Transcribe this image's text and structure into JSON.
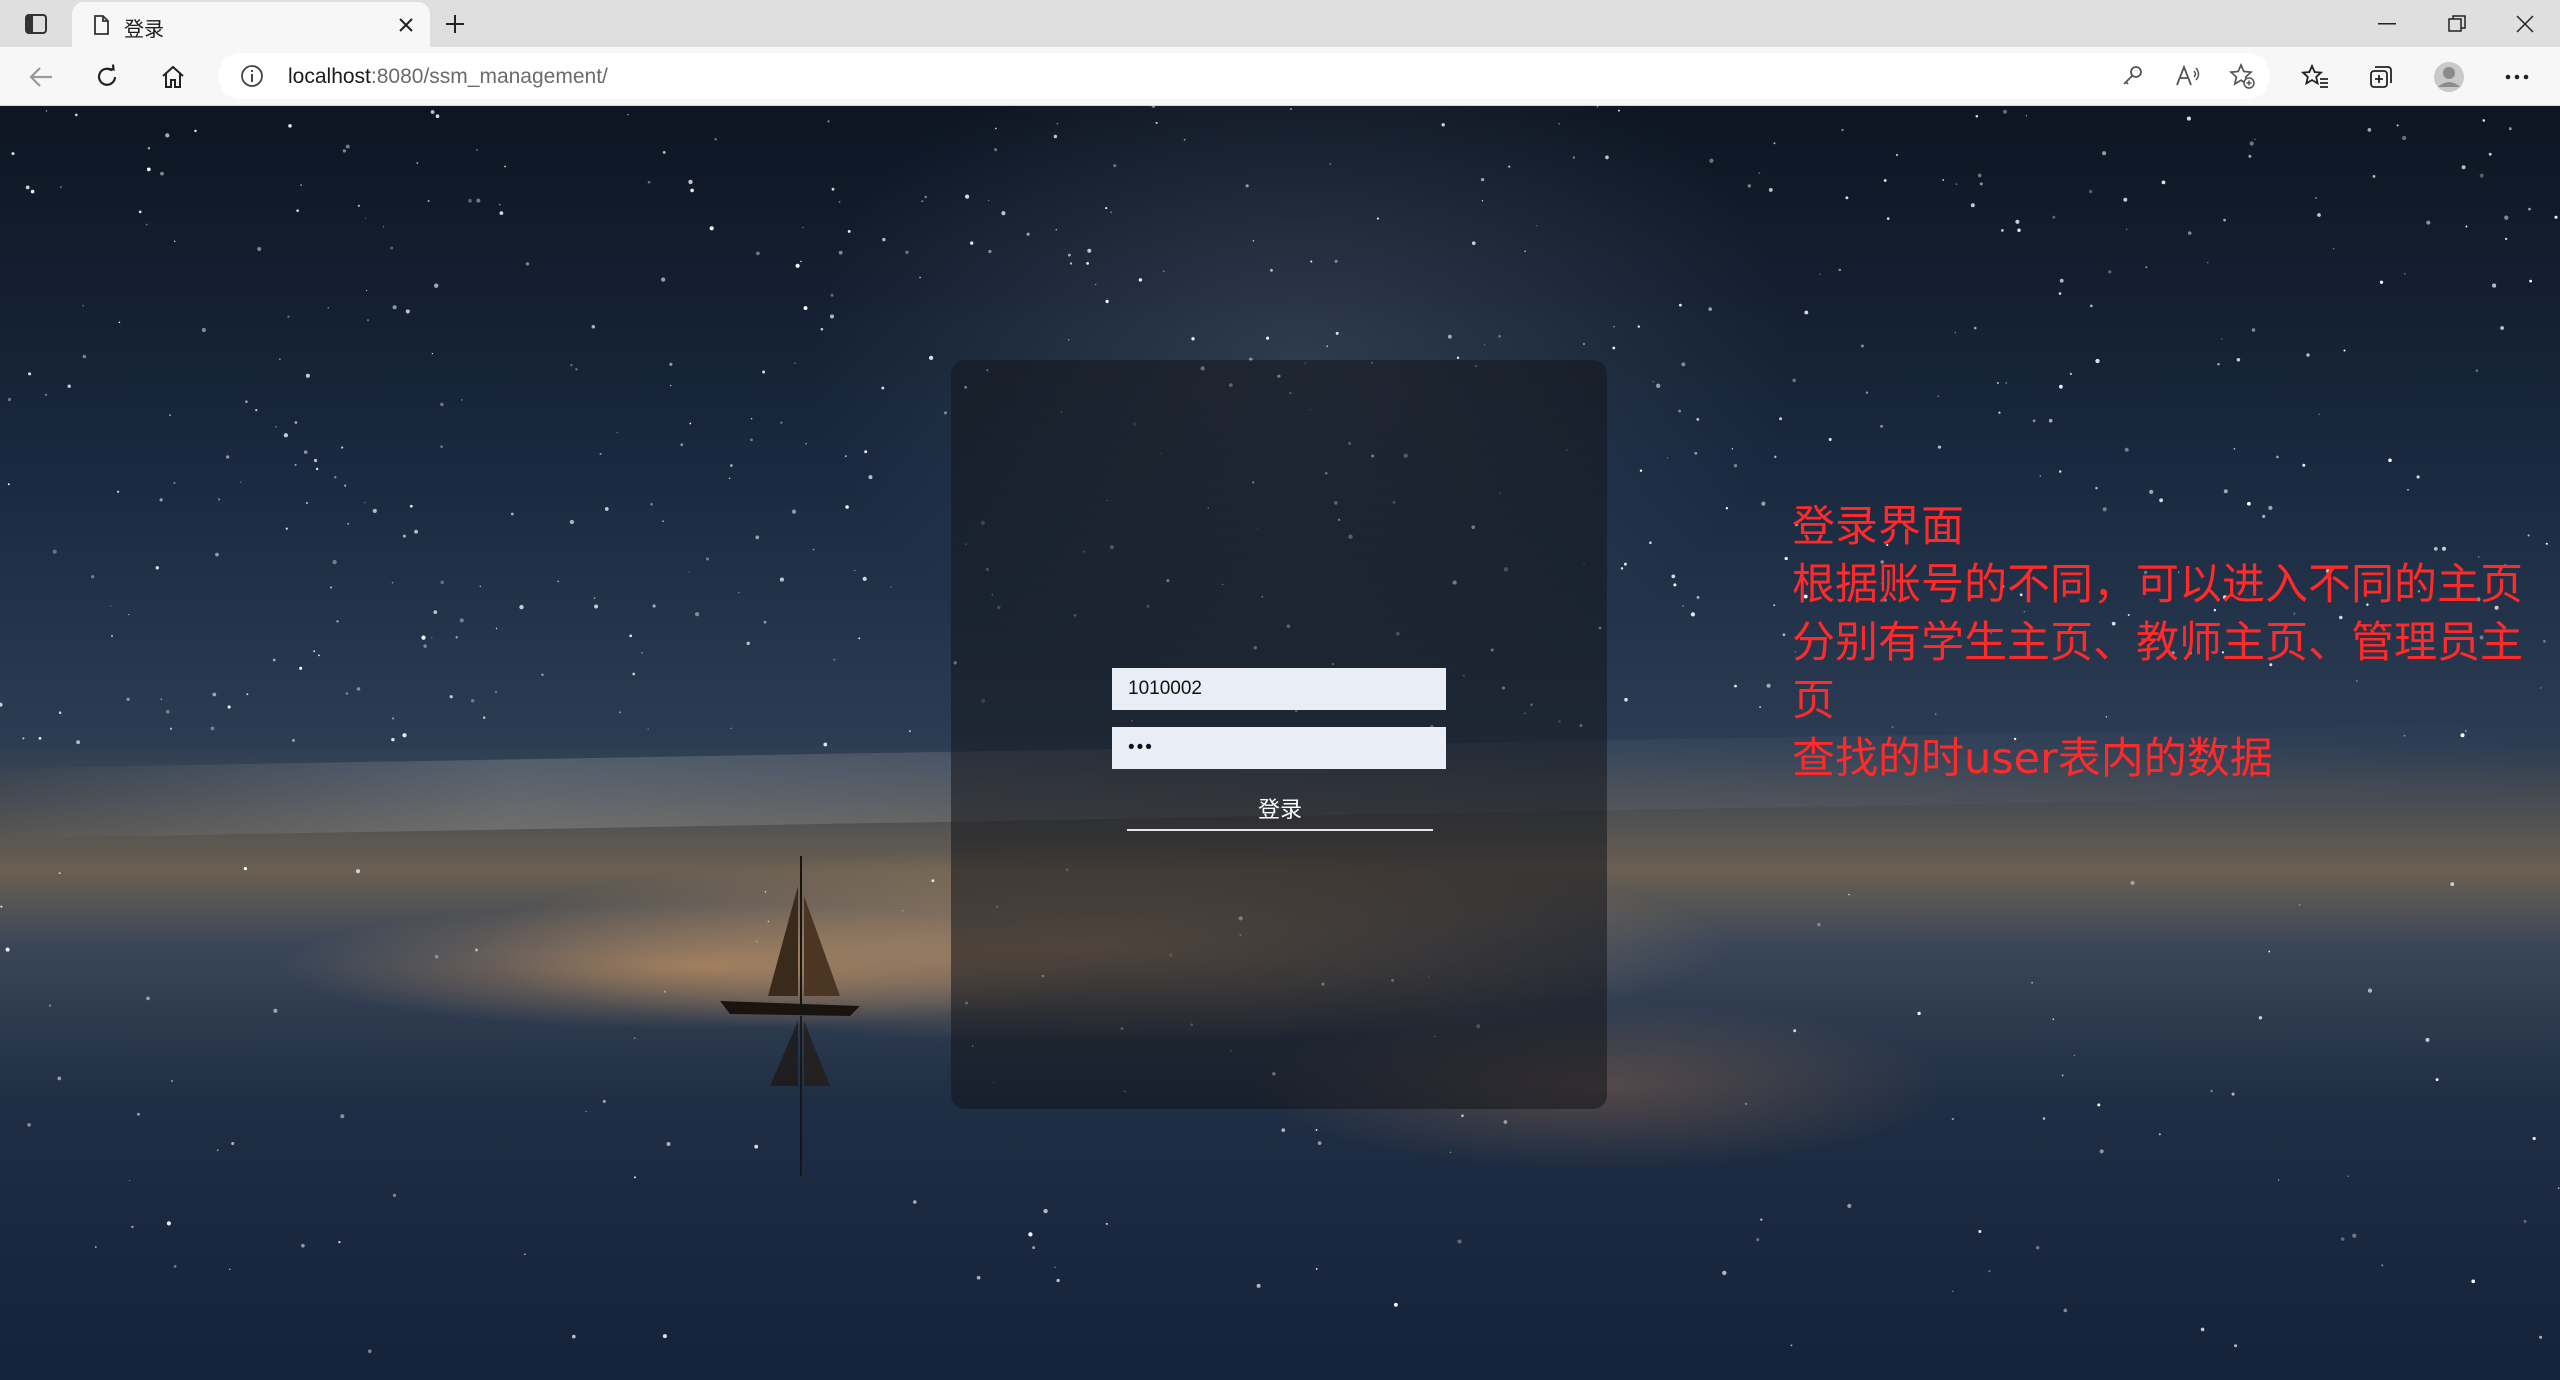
{
  "browser": {
    "tab": {
      "title": "登录"
    },
    "address": {
      "host": "localhost",
      "path": ":8080/ssm_management/"
    }
  },
  "login": {
    "username_value": "1010002",
    "password_value": "•••",
    "submit_label": "登录"
  },
  "annotation": {
    "lines": [
      "登录界面",
      "根据账号的不同，可以进入不同的主页",
      "分别有学生主页、教师主页、管理员主",
      "页",
      "查找的时user表内的数据"
    ]
  }
}
